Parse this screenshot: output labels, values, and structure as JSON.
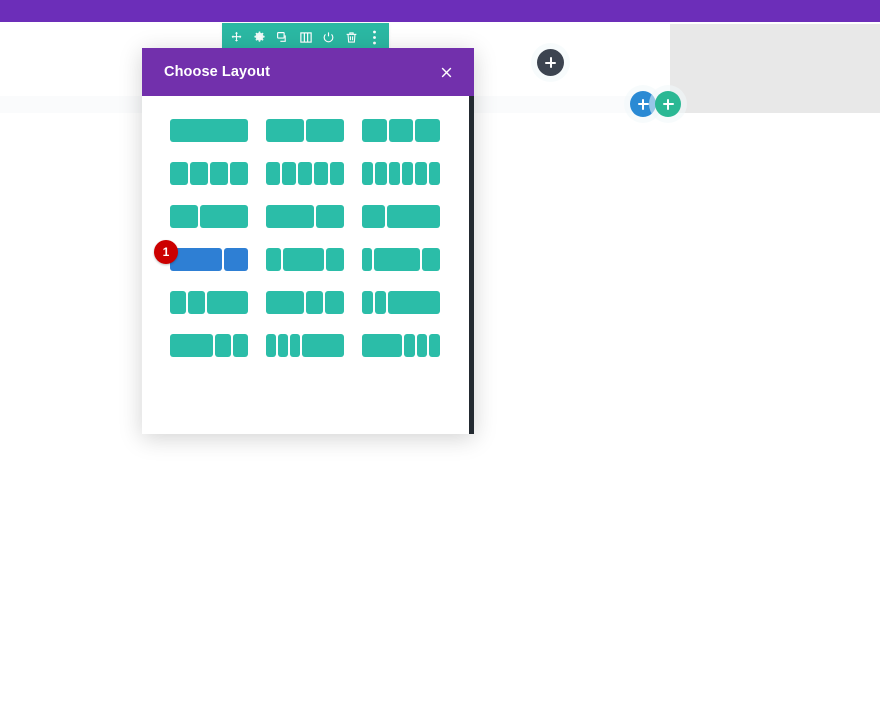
{
  "page": {
    "top_bar_color": "#6c2eb9",
    "canvas_color": "#fafbfc",
    "gray_block_color": "#e8e8e8"
  },
  "module_toolbar": {
    "background": "#2bb8a3",
    "icons": [
      {
        "name": "move-icon",
        "title": "Move Module"
      },
      {
        "name": "gear-icon",
        "title": "Module Settings"
      },
      {
        "name": "duplicate-icon",
        "title": "Duplicate Module"
      },
      {
        "name": "choose-layout-icon",
        "title": "Choose Layout"
      },
      {
        "name": "power-icon",
        "title": "Disable Module"
      },
      {
        "name": "trash-icon",
        "title": "Delete Module"
      },
      {
        "name": "more-options-icon",
        "title": "More Options"
      }
    ]
  },
  "add_buttons": [
    {
      "name": "add-section-button",
      "label": "+",
      "color": "#3c4450"
    },
    {
      "name": "add-row-button",
      "label": "+",
      "color": "#2a8ad4"
    },
    {
      "name": "add-module-button",
      "label": "+",
      "color": "#2bb894"
    }
  ],
  "modal": {
    "title": "Choose Layout",
    "close_label": "×",
    "header_color": "#7230ac",
    "column_color": "#2bbda8",
    "selected_color": "#2e7fd4",
    "badge_color": "#cc0000",
    "selected_badge": "1",
    "scrollbar_thumb_color": "#232a31",
    "layouts": [
      {
        "name": "1-column",
        "columns": [
          100
        ]
      },
      {
        "name": "2-columns",
        "columns": [
          50,
          50
        ]
      },
      {
        "name": "3-columns",
        "columns": [
          33.33,
          33.33,
          33.33
        ]
      },
      {
        "name": "4-columns",
        "columns": [
          25,
          25,
          25,
          25
        ]
      },
      {
        "name": "5-columns",
        "columns": [
          20,
          20,
          20,
          20,
          20
        ]
      },
      {
        "name": "6-columns",
        "columns": [
          16.66,
          16.66,
          16.66,
          16.66,
          16.66,
          16.66
        ]
      },
      {
        "name": "one-third-two-thirds",
        "columns": [
          37,
          63
        ]
      },
      {
        "name": "two-thirds-one-third",
        "columns": [
          63,
          37
        ]
      },
      {
        "name": "one-quarter-three-quarters",
        "columns": [
          30,
          70
        ]
      },
      {
        "name": "three-quarters-one-quarter-selected",
        "columns": [
          68,
          32
        ],
        "selected": true,
        "badge": "1"
      },
      {
        "name": "quarter-half-quarter",
        "columns": [
          20,
          55,
          25
        ]
      },
      {
        "name": "sixth-two-thirds-sixth",
        "columns": [
          13,
          62,
          25
        ]
      },
      {
        "name": "quarter-quarter-half",
        "columns": [
          22,
          22,
          56
        ]
      },
      {
        "name": "half-quarter-quarter",
        "columns": [
          52,
          23,
          25
        ]
      },
      {
        "name": "sixth-sixth-two-thirds",
        "columns": [
          15,
          15,
          70
        ]
      },
      {
        "name": "half-sixth-sixth",
        "columns": [
          56,
          20,
          20
        ]
      },
      {
        "name": "sixth-sixth-sixth-half",
        "columns": [
          13,
          13,
          13,
          55
        ]
      },
      {
        "name": "half-sixth-sixth-sixth",
        "columns": [
          52,
          14,
          14,
          14
        ]
      }
    ]
  }
}
